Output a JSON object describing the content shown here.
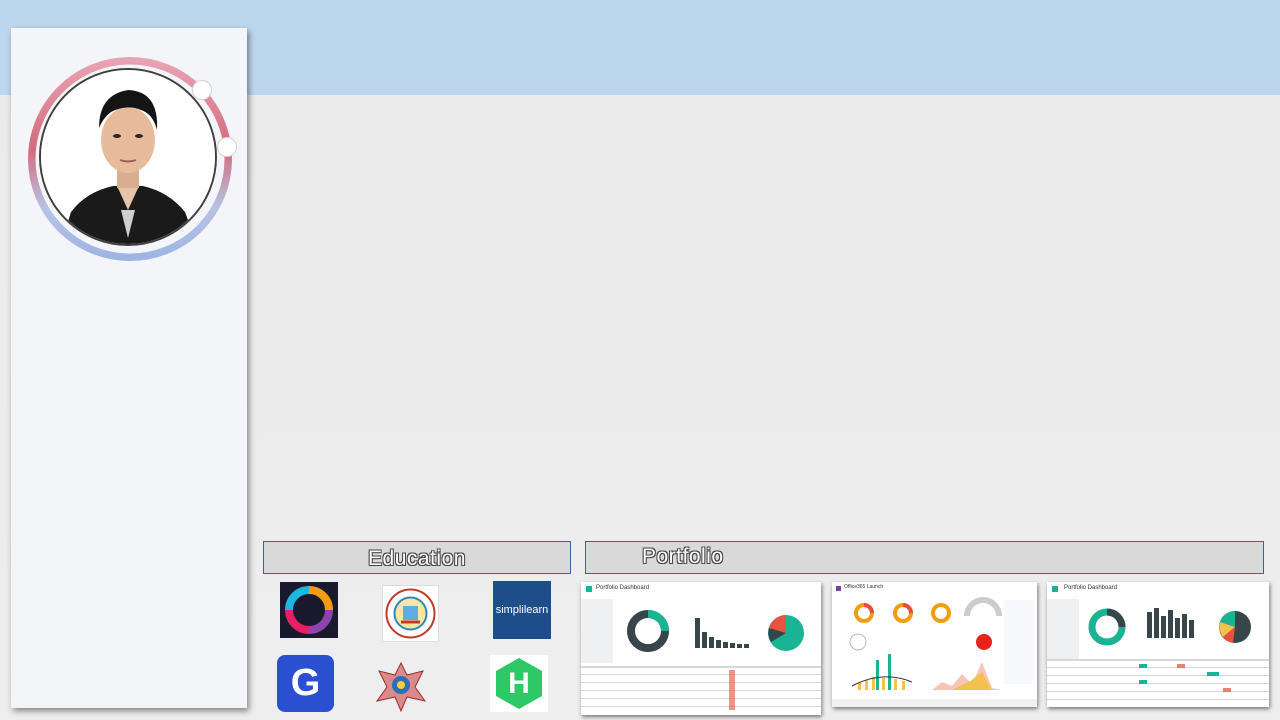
{
  "sections": {
    "education_label": "Education",
    "portfolio_label": "Portfolio"
  },
  "education_logos": [
    {
      "icon": "colorful-swirl-logo"
    },
    {
      "icon": "university-seal-logo"
    },
    {
      "icon": "simplilearn-logo",
      "text": "simplilearn"
    },
    {
      "icon": "g-letter-logo",
      "text": "G"
    },
    {
      "icon": "emblem-logo"
    },
    {
      "icon": "hackerrank-logo",
      "text": "H"
    }
  ],
  "portfolio": [
    {
      "title": "Portfolio Dashboard",
      "icon": "dashboard-thumbnail-1"
    },
    {
      "title": "Office365 Launch",
      "icon": "dashboard-thumbnail-2"
    },
    {
      "title": "Portfolio Dashboard",
      "icon": "dashboard-thumbnail-3"
    }
  ],
  "colors": {
    "top_band": "#bdd7ee",
    "background": "#ececec",
    "card": "#f4f5f9",
    "header_border": "#3b5fa0",
    "teal": "#1ab394",
    "dark": "#374649"
  }
}
